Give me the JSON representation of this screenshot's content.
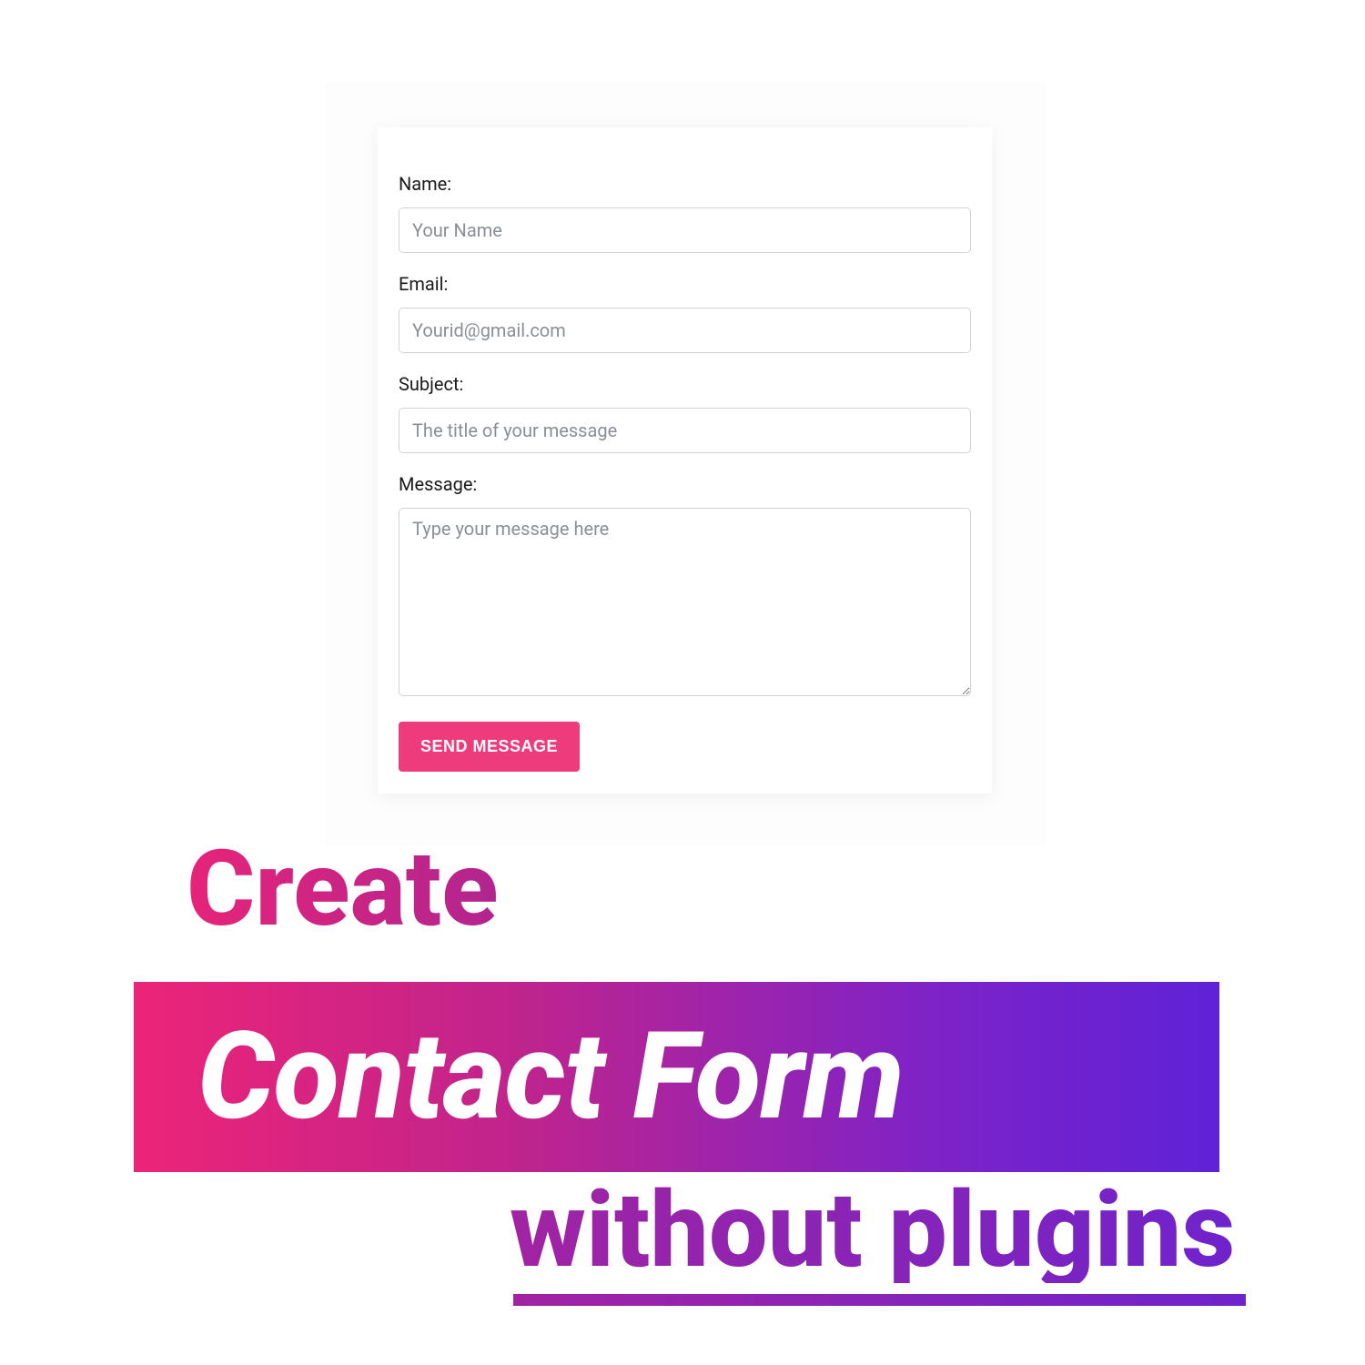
{
  "form": {
    "name": {
      "label": "Name:",
      "placeholder": "Your Name",
      "value": ""
    },
    "email": {
      "label": "Email:",
      "placeholder": "Yourid@gmail.com",
      "value": ""
    },
    "subject": {
      "label": "Subject:",
      "placeholder": "The title of your message",
      "value": ""
    },
    "message": {
      "label": "Message:",
      "placeholder": "Type your message here",
      "value": ""
    },
    "submit_label": "SEND MESSAGE"
  },
  "headline": {
    "line1": "Create",
    "line2": "Contact Form",
    "line3": "without plugins"
  }
}
